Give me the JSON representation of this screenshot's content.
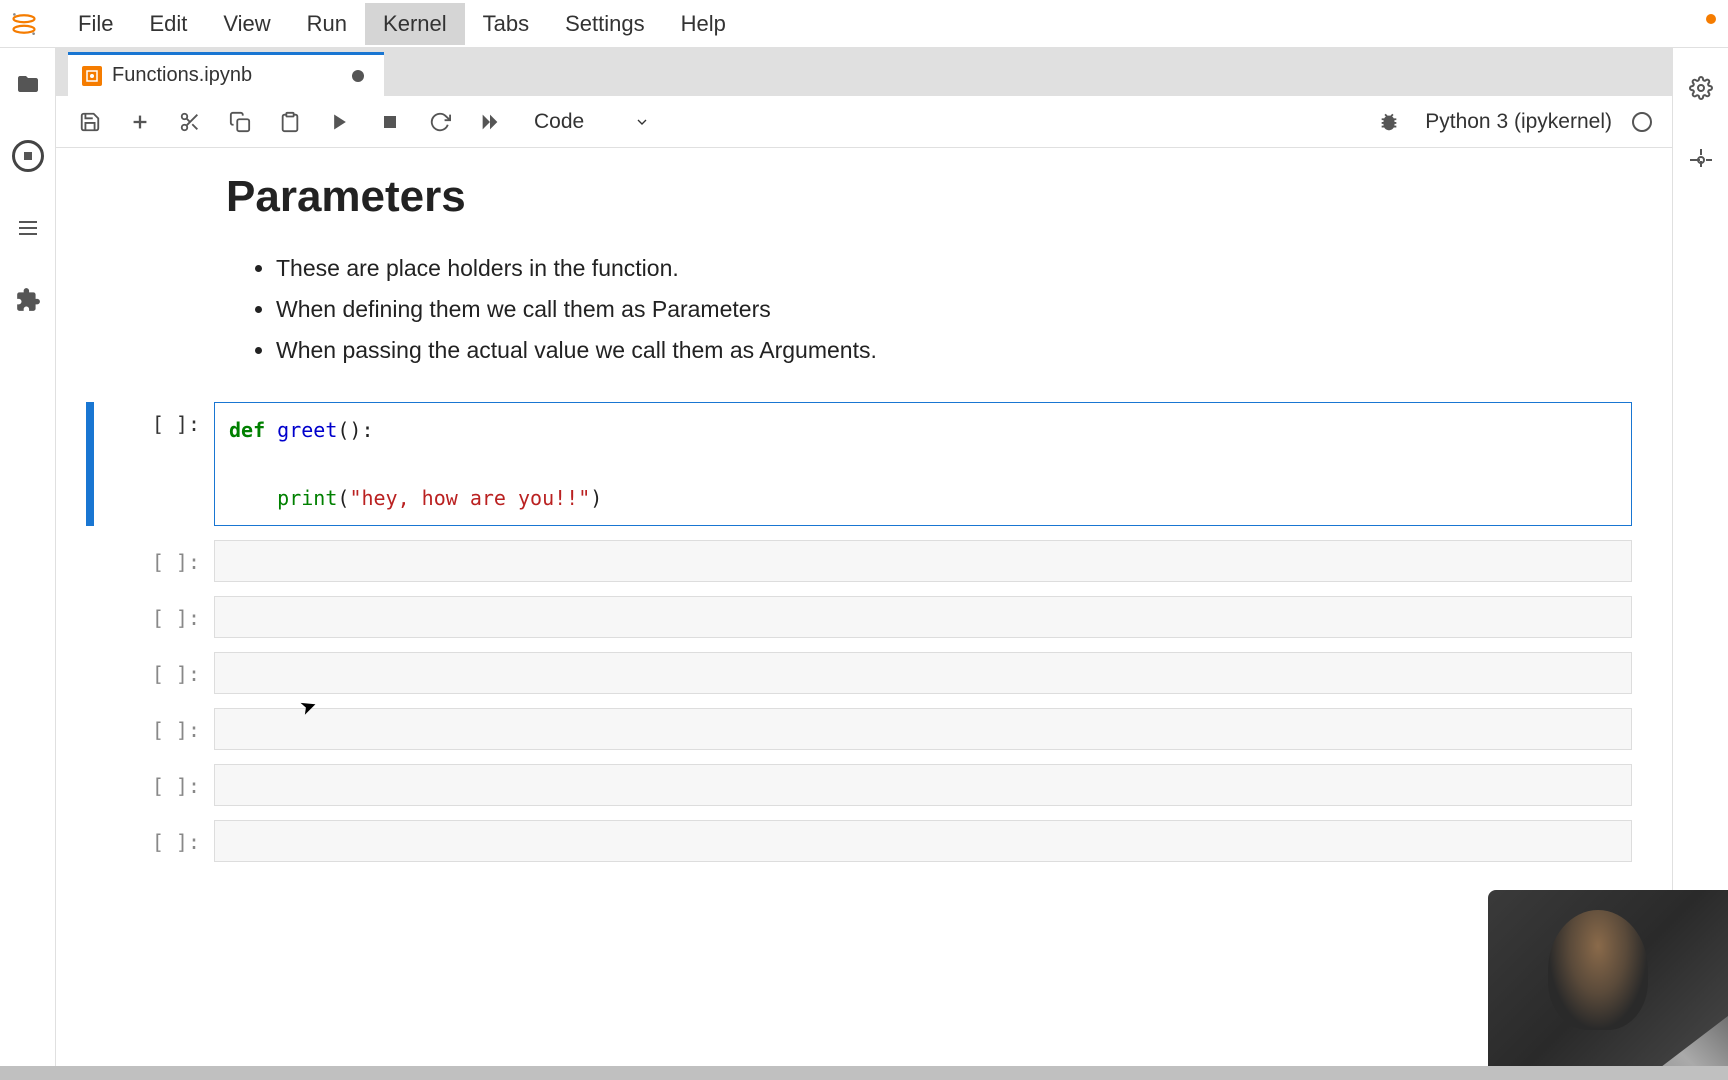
{
  "menu": {
    "items": [
      "File",
      "Edit",
      "View",
      "Run",
      "Kernel",
      "Tabs",
      "Settings",
      "Help"
    ],
    "active_index": 4
  },
  "tab": {
    "filename": "Functions.ipynb",
    "dirty": true
  },
  "toolbar": {
    "cell_type": "Code",
    "kernel_name": "Python 3 (ipykernel)"
  },
  "markdown": {
    "heading": "Parameters",
    "bullets": [
      "These are place holders in the function.",
      "When defining them we call them as Parameters",
      "When passing the actual value we call them as Arguments."
    ]
  },
  "cells": [
    {
      "prompt": "[ ]:",
      "selected": true,
      "code": {
        "def": "def",
        "fname": "greet",
        "parens": "():",
        "print": "print",
        "open": "(",
        "string": "\"hey, how are you!!\"",
        "close": ")"
      }
    },
    {
      "prompt": "[ ]:",
      "selected": false
    },
    {
      "prompt": "[ ]:",
      "selected": false
    },
    {
      "prompt": "[ ]:",
      "selected": false
    },
    {
      "prompt": "[ ]:",
      "selected": false
    },
    {
      "prompt": "[ ]:",
      "selected": false
    },
    {
      "prompt": "[ ]:",
      "selected": false
    }
  ]
}
